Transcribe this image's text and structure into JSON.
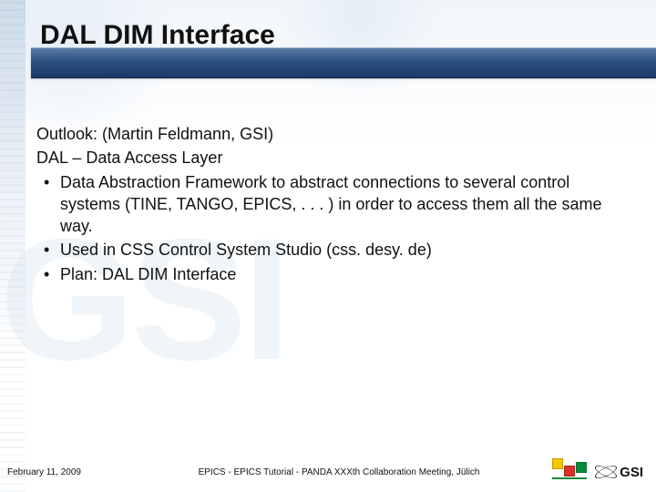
{
  "title": "DAL DIM Interface",
  "body": {
    "line1": "Outlook: (Martin Feldmann, GSI)",
    "line2": "DAL – Data Access Layer",
    "bullets": [
      "Data Abstraction Framework to abstract connections to several control systems (TINE, TANGO, EPICS, . . . ) in order to access them all the same way.",
      "Used in CSS Control System Studio (css. desy. de)",
      "Plan: DAL DIM Interface"
    ]
  },
  "footer": {
    "date": "February 11, 2009",
    "center": "EPICS - EPICS Tutorial - PANDA XXXth Collaboration Meeting, Jülich"
  },
  "logos": {
    "squares": "panda-collab-icon",
    "gsi_text": "GSI"
  },
  "watermark": "GSI"
}
